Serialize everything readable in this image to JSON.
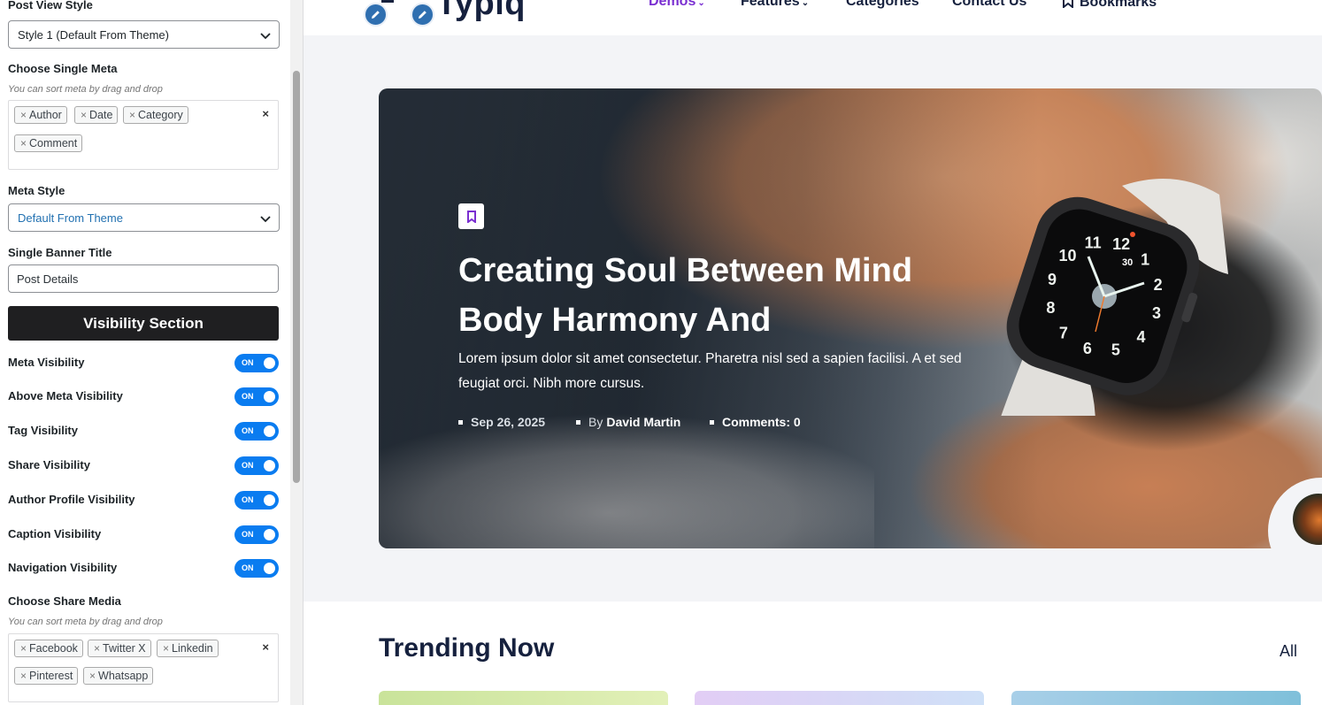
{
  "panel": {
    "post_view_style": {
      "label": "Post View Style",
      "value": "Style 1 (Default From Theme)"
    },
    "single_meta": {
      "label": "Choose Single Meta",
      "hint": "You can sort meta by drag and drop",
      "chips": [
        "Author",
        "Date",
        "Category",
        "Comment"
      ],
      "clear": "×"
    },
    "meta_style": {
      "label": "Meta Style",
      "value": "Default From Theme"
    },
    "banner_title": {
      "label": "Single Banner Title",
      "value": "Post Details"
    },
    "visibility_section": "Visibility Section",
    "toggles": [
      {
        "label": "Meta Visibility",
        "state": "ON"
      },
      {
        "label": "Above Meta Visibility",
        "state": "ON"
      },
      {
        "label": "Tag Visibility",
        "state": "ON"
      },
      {
        "label": "Share Visibility",
        "state": "ON"
      },
      {
        "label": "Author Profile Visibility",
        "state": "ON"
      },
      {
        "label": "Caption Visibility",
        "state": "ON"
      },
      {
        "label": "Navigation Visibility",
        "state": "ON"
      }
    ],
    "share_media": {
      "label": "Choose Share Media",
      "hint": "You can sort meta by drag and drop",
      "chips": [
        "Facebook",
        "Twitter X",
        "Linkedin",
        "Pinterest",
        "Whatsapp"
      ],
      "clear": "×"
    },
    "toggle_color": "#0a7cf0"
  },
  "site": {
    "logo": "Typiq",
    "nav": [
      {
        "label": "Demos",
        "caret": "⌄"
      },
      {
        "label": "Features",
        "caret": "⌄"
      },
      {
        "label": "Categories"
      },
      {
        "label": "Contact Us"
      },
      {
        "label": "Bookmarks"
      }
    ],
    "accent": "#7a2fd1",
    "hero": {
      "title": "Creating Soul Between Mind Body Harmony And",
      "excerpt": "Lorem ipsum dolor sit amet consectetur. Pharetra nisl sed a sapien facilisi. A et sed feugiat orci. Nibh more cursus.",
      "date": "Sep 26, 2025",
      "by": "By",
      "author": "David Martin",
      "comments": "Comments: 0"
    },
    "watch": {
      "numbers": [
        "12",
        "1",
        "2",
        "3",
        "4",
        "5",
        "6",
        "7",
        "8",
        "9",
        "10",
        "11"
      ],
      "date_num": "30"
    },
    "trending": {
      "title": "Trending Now",
      "all": "All"
    }
  }
}
